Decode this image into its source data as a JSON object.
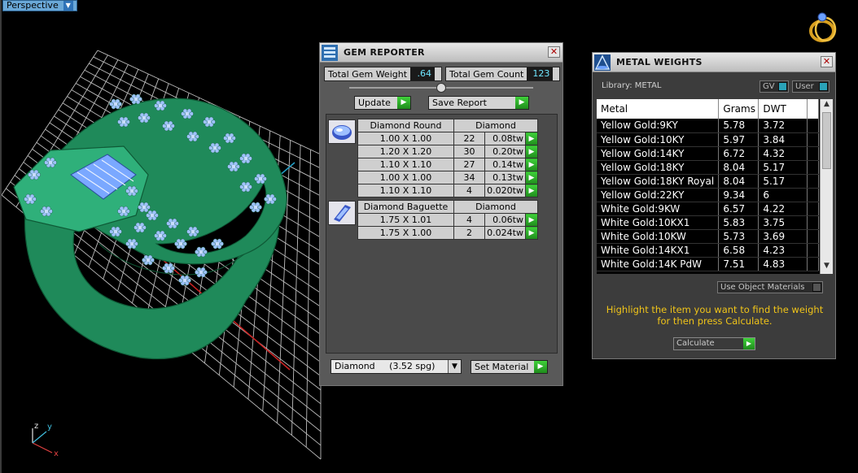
{
  "viewport": {
    "label": "Perspective",
    "axis_labels": {
      "z": "z",
      "y": "y",
      "x": "x"
    }
  },
  "gem_reporter": {
    "title": "GEM REPORTER",
    "total_weight_label": "Total Gem Weight",
    "total_weight_value": ".64",
    "total_count_label": "Total Gem Count",
    "total_count_value": "123",
    "update_label": "Update",
    "save_report_label": "Save Report",
    "groups": [
      {
        "shape": "Diamond Round",
        "material": "Diamond",
        "rows": [
          {
            "size": "1.00 X 1.00",
            "count": "22",
            "tw": "0.08tw"
          },
          {
            "size": "1.20 X 1.20",
            "count": "30",
            "tw": "0.20tw"
          },
          {
            "size": "1.10 X 1.10",
            "count": "27",
            "tw": "0.14tw"
          },
          {
            "size": "1.00 X 1.00",
            "count": "34",
            "tw": "0.13tw"
          },
          {
            "size": "1.10 X 1.10",
            "count": "4",
            "tw": "0.020tw"
          }
        ]
      },
      {
        "shape": "Diamond Baguette",
        "material": "Diamond",
        "rows": [
          {
            "size": "1.75 X 1.01",
            "count": "4",
            "tw": "0.06tw"
          },
          {
            "size": "1.75 X 1.00",
            "count": "2",
            "tw": "0.024tw"
          }
        ]
      }
    ],
    "material_select": "Diamond     (3.52 spg)",
    "set_material_label": "Set Material"
  },
  "metal_weights": {
    "title": "METAL WEIGHTS",
    "library_label": "Library: METAL",
    "toggle_gv": "GV",
    "toggle_user": "User",
    "columns": [
      "Metal",
      "Grams",
      "DWT"
    ],
    "rows": [
      [
        "Yellow Gold:9KY",
        "5.78",
        "3.72"
      ],
      [
        "Yellow Gold:10KY",
        "5.97",
        "3.84"
      ],
      [
        "Yellow Gold:14KY",
        "6.72",
        "4.32"
      ],
      [
        "Yellow Gold:18KY",
        "8.04",
        "5.17"
      ],
      [
        "Yellow Gold:18KY Royal",
        "8.04",
        "5.17"
      ],
      [
        "Yellow Gold:22KY",
        "9.34",
        "6"
      ],
      [
        "White Gold:9KW",
        "6.57",
        "4.22"
      ],
      [
        "White Gold:10KX1",
        "5.83",
        "3.75"
      ],
      [
        "White Gold:10KW",
        "5.73",
        "3.69"
      ],
      [
        "White Gold:14KX1",
        "6.58",
        "4.23"
      ],
      [
        "White Gold:14K PdW",
        "7.51",
        "4.83"
      ]
    ],
    "use_object_materials": "Use Object Materials",
    "hint": "Highlight the item you want to find the weight for then press Calculate.",
    "calculate_label": "Calculate"
  }
}
